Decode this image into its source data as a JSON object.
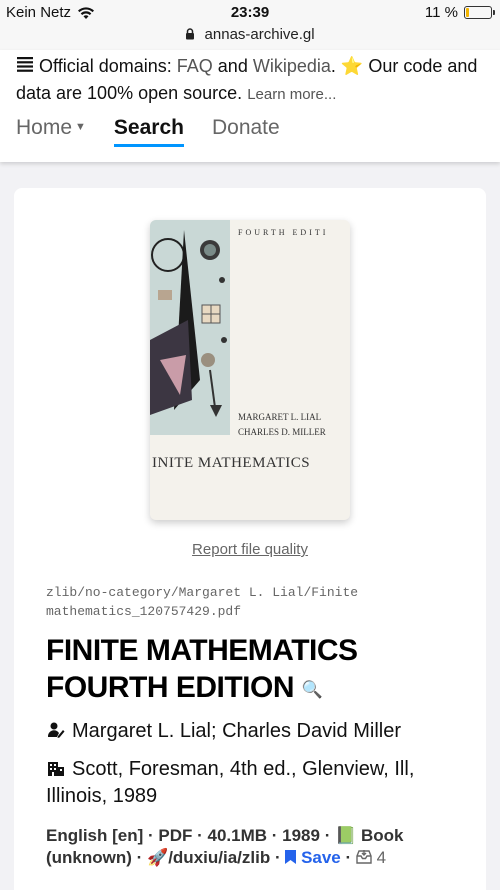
{
  "status_bar": {
    "carrier": "Kein Netz",
    "time": "23:39",
    "battery_text": "11 %",
    "battery_level": 0.11,
    "battery_color": "#f2b400"
  },
  "browser": {
    "url": "annas-archive.gl",
    "lock_icon": "lock-icon"
  },
  "banner": {
    "icon": "list-icon",
    "prefix": "Official domains:",
    "link_faq": "FAQ",
    "and1": "and",
    "link_wikipedia": "Wikipedia",
    "star": "⭐",
    "suffix": "Our code and data are 100% open source.",
    "learn_more": "Learn more..."
  },
  "nav": {
    "home": "Home",
    "search": "Search",
    "donate": "Donate",
    "active_color": "#0095ff"
  },
  "cover": {
    "edition": "FOURTH EDITI",
    "author1": "MARGARET L. LIAL",
    "author2": "CHARLES D. MILLER",
    "title": "INITE MATHEMATICS"
  },
  "report_link": "Report file quality",
  "file_path": "zlib/no-category/Margaret L. Lial/Finite mathematics_120757429.pdf",
  "book": {
    "title": "FINITE MATHEMATICS FOURTH EDITION",
    "search_icon": "🔍",
    "authors": "Margaret L. Lial; Charles David Miller",
    "publisher": "Scott, Foresman, 4th ed., Glenview, Ill, Illinois, 1989"
  },
  "details": {
    "language": "English [en]",
    "format": "PDF",
    "size": "40.1MB",
    "year": "1989",
    "type_emoji": "📗",
    "type": "Book (unknown)",
    "source_emoji": "🚀",
    "source": "/duxiu/ia/zlib",
    "save_icon": "bookmark-icon",
    "save": "Save",
    "lists_count": "4"
  }
}
